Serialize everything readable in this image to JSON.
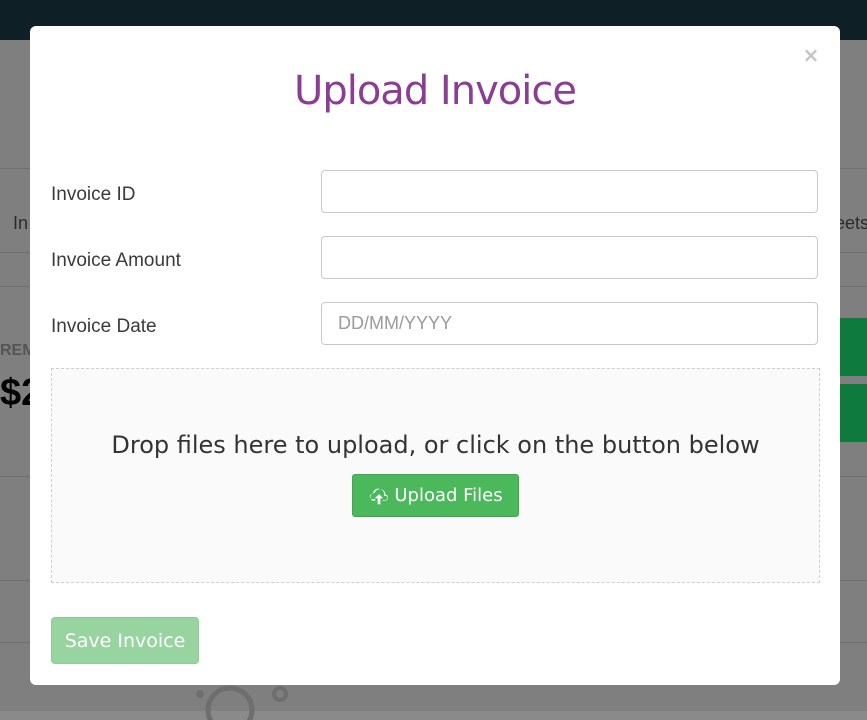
{
  "background": {
    "tab_left": "In",
    "tab_right": "eets",
    "label_fragment": "REM",
    "amount_fragment": "$2"
  },
  "modal": {
    "title": "Upload Invoice",
    "close_glyph": "×",
    "fields": {
      "invoice_id": {
        "label": "Invoice ID",
        "value": "",
        "placeholder": ""
      },
      "invoice_amount": {
        "label": "Invoice Amount",
        "value": "",
        "placeholder": ""
      },
      "invoice_date": {
        "label": "Invoice Date",
        "value": "",
        "placeholder": "DD/MM/YYYY"
      }
    },
    "dropzone": {
      "text": "Drop files here to upload, or click on the button below",
      "button_label": "Upload Files",
      "button_icon": "cloud-upload-icon"
    },
    "save_label": "Save Invoice"
  },
  "colors": {
    "title": "#8b3d94",
    "upload_button": "#4cb85c",
    "save_button_disabled": "#97d49f",
    "topbar": "#0e2025"
  }
}
